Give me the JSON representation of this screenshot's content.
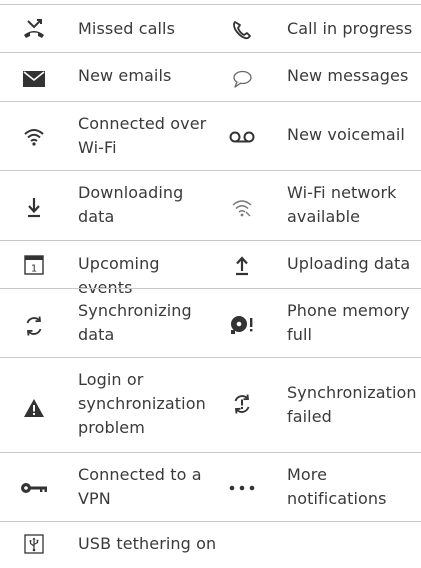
{
  "rows": [
    {
      "left": {
        "icon": "missed-call-icon",
        "label": "Missed calls"
      },
      "right": {
        "icon": "phone-in-call-icon",
        "label": "Call in progress"
      }
    },
    {
      "left": {
        "icon": "envelope-icon",
        "label": "New emails"
      },
      "right": {
        "icon": "speech-bubble-icon",
        "label": "New messages"
      }
    },
    {
      "left": {
        "icon": "wifi-icon",
        "label": "Connected over Wi-Fi"
      },
      "right": {
        "icon": "voicemail-icon",
        "label": "New voicemail"
      }
    },
    {
      "left": {
        "icon": "download-icon",
        "label": "Downloading data"
      },
      "right": {
        "icon": "wifi-available-icon",
        "label": "Wi-Fi network available"
      }
    },
    {
      "left": {
        "icon": "calendar-icon",
        "label": "Upcoming events",
        "calendar_day": "1"
      },
      "right": {
        "icon": "upload-icon",
        "label": "Uploading data"
      }
    },
    {
      "left": {
        "icon": "sync-icon",
        "label": "Synchronizing data"
      },
      "right": {
        "icon": "memory-full-icon",
        "label": "Phone memory full"
      }
    },
    {
      "left": {
        "icon": "warning-icon",
        "label": "Login or synchronization problem"
      },
      "right": {
        "icon": "sync-failed-icon",
        "label": "Synchronization failed"
      }
    },
    {
      "left": {
        "icon": "vpn-key-icon",
        "label": "Connected to a VPN"
      },
      "right": {
        "icon": "more-dots-icon",
        "label": "More notifications"
      }
    },
    {
      "left": {
        "icon": "usb-icon",
        "label": "USB tethering on"
      }
    }
  ]
}
